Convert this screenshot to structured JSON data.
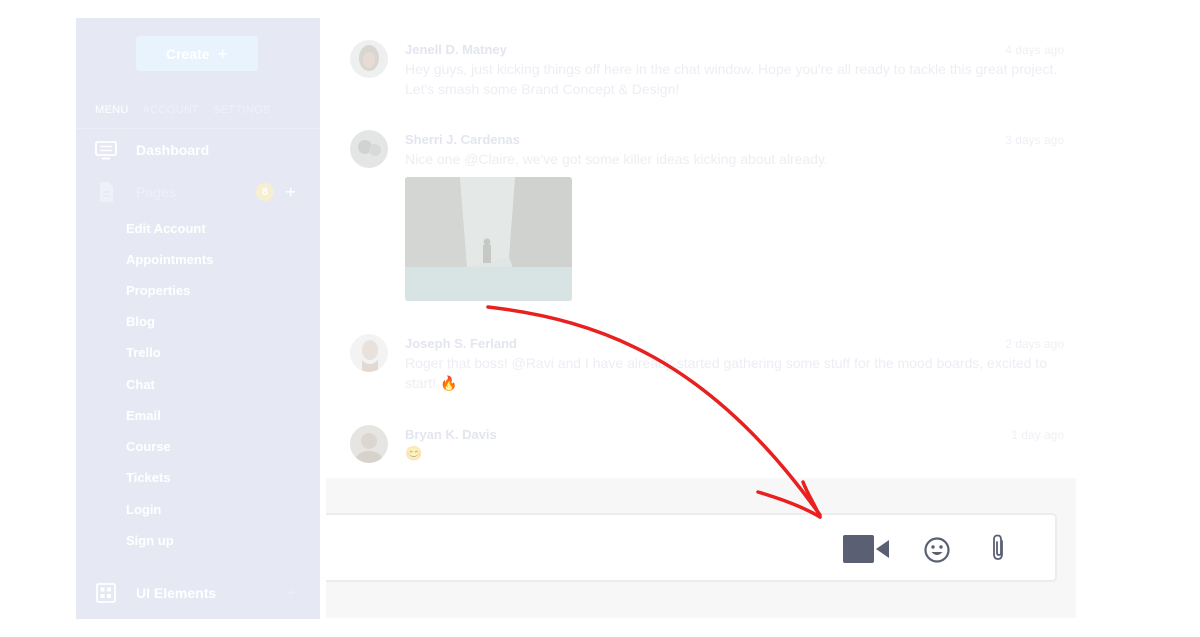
{
  "sidebar": {
    "create_label": "Create",
    "tabs": [
      "MENU",
      "ACCOUNT",
      "SETTINGS"
    ],
    "nav": {
      "dashboard": "Dashboard",
      "pages": "Pages",
      "pages_badge": "8",
      "ui_elements": "UI Elements"
    },
    "sub_items": [
      "Edit Account",
      "Appointments",
      "Properties",
      "Blog",
      "Trello",
      "Chat",
      "Email",
      "Course",
      "Tickets",
      "Login",
      "Sign up"
    ]
  },
  "messages": [
    {
      "author": "Jenell D. Matney",
      "time": "4 days ago",
      "text": "Hey guys, just kicking things off here in the chat window. Hope you're all ready to tackle this great project. Let's smash some Brand Concept & Design!"
    },
    {
      "author": "Sherri J. Cardenas",
      "time": "3 days ago",
      "text": "Nice one @Claire, we've got some killer ideas kicking about already."
    },
    {
      "author": "Joseph S. Ferland",
      "time": "2 days ago",
      "text": "Roger that boss! @Ravi and I have already started gathering some stuff for the mood boards, excited to start! 🔥"
    },
    {
      "author": "Bryan K. Davis",
      "time": "1 day ago",
      "text": "😊"
    }
  ],
  "composer": {
    "placeholder": ""
  },
  "colors": {
    "arrow": "#e8201f",
    "video_icon": "#5a5f73",
    "tool_icon": "#5a5f73"
  }
}
